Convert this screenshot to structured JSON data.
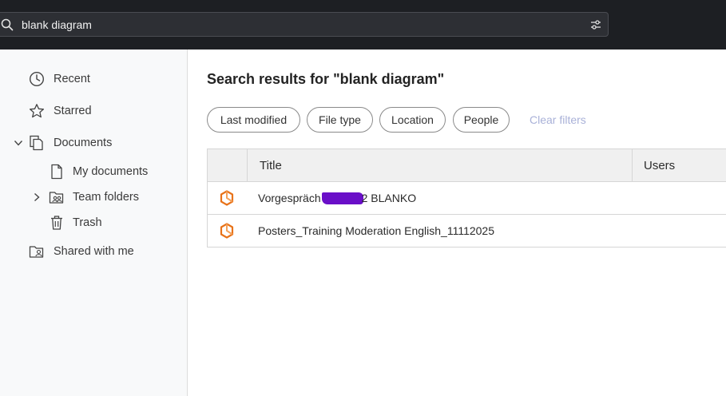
{
  "search": {
    "value": "blank diagram"
  },
  "sidebar": {
    "recent": "Recent",
    "starred": "Starred",
    "documents": "Documents",
    "my_documents": "My documents",
    "team_folders": "Team folders",
    "trash": "Trash",
    "shared_with_me": "Shared with me"
  },
  "main": {
    "title": "Search results for \"blank diagram\"",
    "filters": {
      "last_modified": "Last modified",
      "file_type": "File type",
      "location": "Location",
      "people": "People",
      "clear": "Clear filters"
    },
    "columns": {
      "title": "Title",
      "users": "Users"
    },
    "rows": [
      {
        "title_before": "Vorgespräch",
        "title_after": "2 BLANKO",
        "icon": "lucid-diagram-icon"
      },
      {
        "title": "Posters_Training Moderation English_11112025",
        "icon": "lucid-diagram-icon"
      }
    ]
  },
  "colors": {
    "topbar": "#1d1f23",
    "accent_orange": "#e8731a",
    "clear_filters": "#a9b1d8",
    "redaction": "#6a0fc8"
  }
}
